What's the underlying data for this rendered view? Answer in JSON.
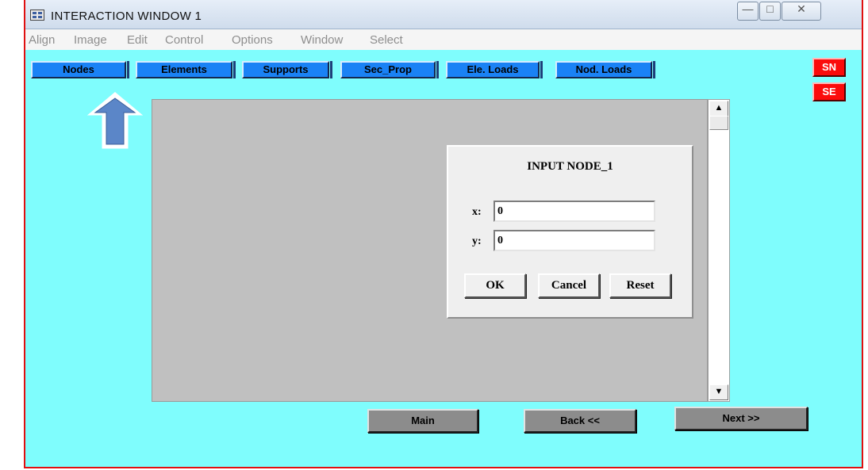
{
  "window": {
    "title": "INTERACTION WINDOW 1",
    "minimize_glyph": "—",
    "restore_glyph": "□",
    "close_glyph": "✕",
    "accent": "#7ffdfd"
  },
  "menu": [
    "Align",
    "Image",
    "Edit",
    "Control",
    "Options",
    "Window",
    "Select"
  ],
  "toolbar": [
    "Nodes",
    "Elements",
    "Supports",
    "Sec_Prop",
    "Ele. Loads",
    "Nod. Loads"
  ],
  "side_buttons": {
    "sn": "SN",
    "se": "SE"
  },
  "dialog": {
    "title": "INPUT NODE_1",
    "x_label": "x:",
    "x_value": "0",
    "y_label": "y:",
    "y_value": "0",
    "ok": "OK",
    "cancel": "Cancel",
    "reset": "Reset"
  },
  "nav": {
    "main": "Main",
    "back": "Back <<",
    "next": "Next >>"
  },
  "icons": {
    "arrow": "up-arrow-icon",
    "scroll_up": "▲",
    "scroll_down": "▼"
  },
  "colors": {
    "toolbar_button": "#1a82f5",
    "red_button": "#fb0b0b",
    "nav_button": "#8c8c8c",
    "canvas": "#c0c0c0"
  }
}
